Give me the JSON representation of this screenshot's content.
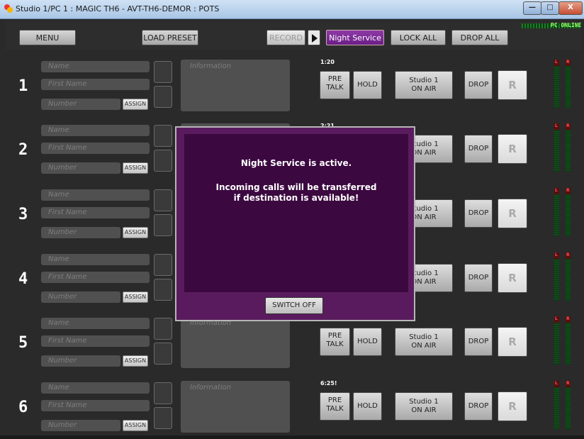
{
  "window": {
    "title": "Studio 1/PC 1 : MAGIC TH6 - AVT-TH6-DEMOR : POTS",
    "min_label": "—",
    "max_label": "□",
    "close_label": "X"
  },
  "status": {
    "pc_online": "PC ONLINE"
  },
  "toolbar": {
    "menu": "MENU",
    "load_preset": "LOAD PRESET",
    "record": "RECORD",
    "night_service": "Night Service",
    "lock_all": "LOCK ALL",
    "drop_all": "DROP ALL"
  },
  "placeholders": {
    "name": "Name",
    "first_name": "First Name",
    "number": "Number",
    "information": "Information",
    "assign": "ASSIGN"
  },
  "line_controls": {
    "pre_talk_line1": "PRE",
    "pre_talk_line2": "TALK",
    "hold": "HOLD",
    "studio_line1": "Studio 1",
    "studio_line2": "ON AIR",
    "drop": "DROP",
    "r": "R",
    "meter_left": "L",
    "meter_right": "R"
  },
  "lines": [
    {
      "number": "1",
      "timer": "1:20"
    },
    {
      "number": "2",
      "timer": "2:21"
    },
    {
      "number": "3",
      "timer": ""
    },
    {
      "number": "4",
      "timer": ""
    },
    {
      "number": "5",
      "timer": ""
    },
    {
      "number": "6",
      "timer": "6:25!"
    }
  ],
  "dialog": {
    "message_title": "Night Service is active.",
    "message_line1": "Incoming calls will be transferred",
    "message_line2": "if destination is available!",
    "switch_off": "SWITCH OFF"
  },
  "colors": {
    "night_service": "#7a2a94",
    "dialog_bg": "#3b0840",
    "dialog_frame": "#5a1b5e",
    "meter_green": "#12541c",
    "online_green": "#9cff6b"
  }
}
